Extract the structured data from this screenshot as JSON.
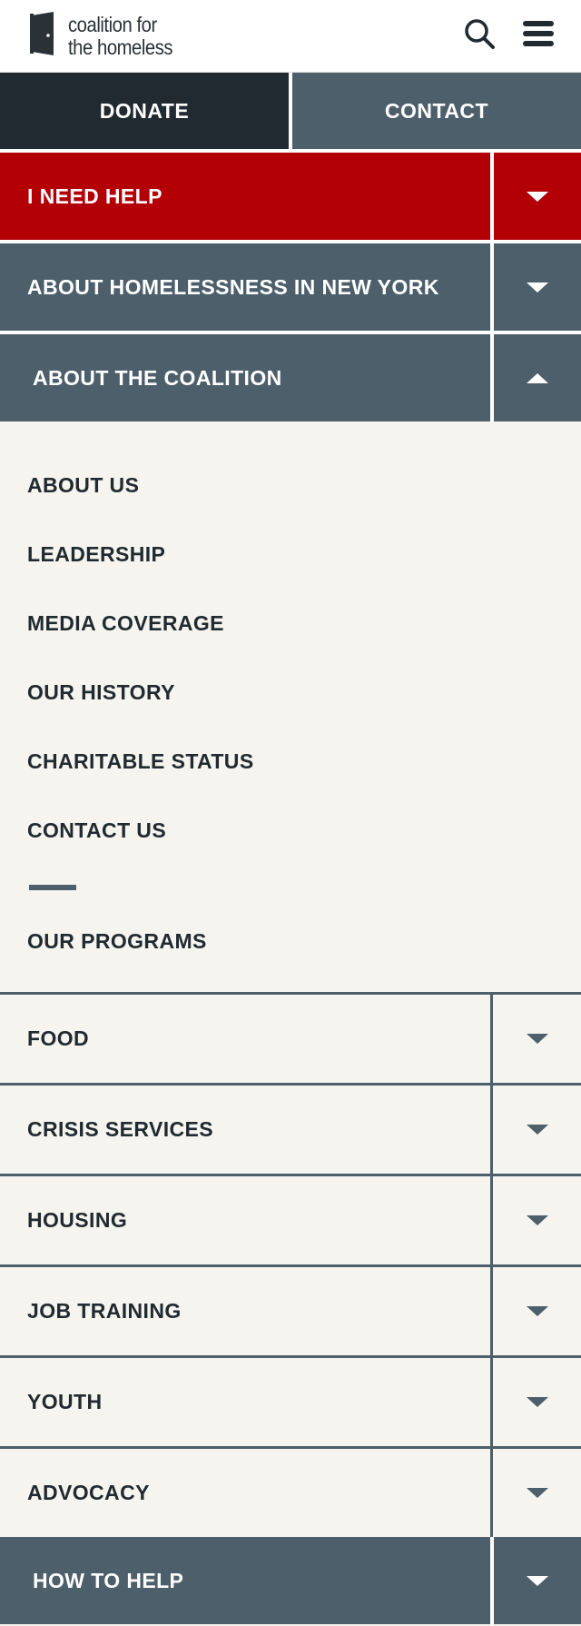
{
  "header": {
    "logo_line1": "coalition for",
    "logo_line2": "the homeless",
    "logo_icon": "door-icon",
    "search_icon": "search-icon",
    "menu_icon": "hamburger-menu-icon"
  },
  "cta": {
    "donate_label": "DONATE",
    "contact_label": "CONTACT"
  },
  "nav": {
    "need_help": "I NEED HELP",
    "about_homelessness": "ABOUT HOMELESSNESS IN NEW YORK",
    "about_coalition": "ABOUT THE COALITION",
    "about_coalition_items": [
      "ABOUT US",
      "LEADERSHIP",
      "MEDIA COVERAGE",
      "OUR HISTORY",
      "CHARITABLE STATUS",
      "CONTACT US"
    ],
    "our_programs": "OUR PROGRAMS",
    "program_items": [
      "FOOD",
      "CRISIS SERVICES",
      "HOUSING",
      "JOB TRAINING",
      "YOUTH",
      "ADVOCACY"
    ],
    "how_to_help": "HOW TO HELP"
  },
  "colors": {
    "brand_red": "#b20006",
    "slate": "#4c5f6b",
    "dark": "#212a30",
    "cream": "#f5f4ef"
  }
}
